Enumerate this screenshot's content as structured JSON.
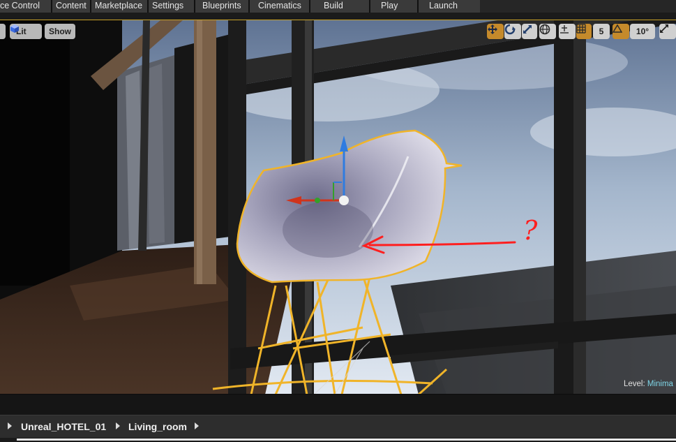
{
  "toolbar": {
    "items": [
      "ce Control",
      "Content",
      "Marketplace",
      "Settings",
      "Blueprints",
      "Cinematics",
      "Build",
      "Play",
      "Launch"
    ]
  },
  "viewport": {
    "lit_label": "Lit",
    "show_label": "Show",
    "grid_snap_value": "5",
    "rotation_snap_value": "10°",
    "level_label": "Level:",
    "level_value": "Minima",
    "annotation_text": "?"
  },
  "breadcrumb": {
    "items": [
      "Unreal_HOTEL_01",
      "Living_room"
    ]
  },
  "colors": {
    "accent_orange": "#c58a2b",
    "selection_outline": "#f0b429",
    "gizmo_x": "#d0341c",
    "gizmo_y": "#34a02a",
    "gizmo_z": "#2f7ce0",
    "annotation_red": "#ff1f1f",
    "level_value_color": "#7fd6e8"
  },
  "icons": [
    "lit-cube-icon",
    "translate-icon",
    "rotate-icon",
    "scale-icon",
    "world-local-icon",
    "surface-snap-icon",
    "grid-snap-icon",
    "rotation-snap-icon",
    "maximize-icon",
    "breadcrumb-arrow-icon"
  ]
}
